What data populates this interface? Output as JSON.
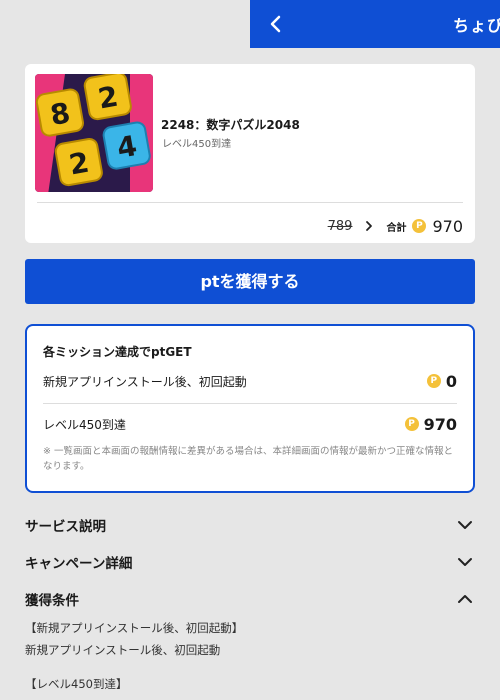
{
  "header": {
    "title": "ちょび"
  },
  "app": {
    "name": "2248：数字パズル2048",
    "subtitle": "レベル450到達",
    "icon_tiles": [
      "8",
      "2",
      "2",
      "4"
    ]
  },
  "points": {
    "old": "789",
    "total_label": "合計",
    "total": "970",
    "coin_symbol": "P"
  },
  "cta": {
    "label": "ptを獲得する"
  },
  "missions": {
    "title": "各ミッション達成でptGET",
    "rows": [
      {
        "label": "新規アプリインストール後、初回起動",
        "pts": "0"
      },
      {
        "label": "レベル450到達",
        "pts": "970"
      }
    ],
    "note": "※ 一覧画面と本画面の報酬情報に差異がある場合は、本詳細画面の情報が最新かつ正確な情報となります。"
  },
  "sections": [
    {
      "title": "サービス説明",
      "expanded": false
    },
    {
      "title": "キャンペーン詳細",
      "expanded": false
    },
    {
      "title": "獲得条件",
      "expanded": true
    }
  ],
  "conditions": [
    "【新規アプリインストール後、初回起動】",
    "新規アプリインストール後、初回起動",
    "【レベル450到達】"
  ],
  "colors": {
    "brand": "#0f4fd4",
    "coin": "#f4c13a",
    "background": "#e6e6e6"
  }
}
